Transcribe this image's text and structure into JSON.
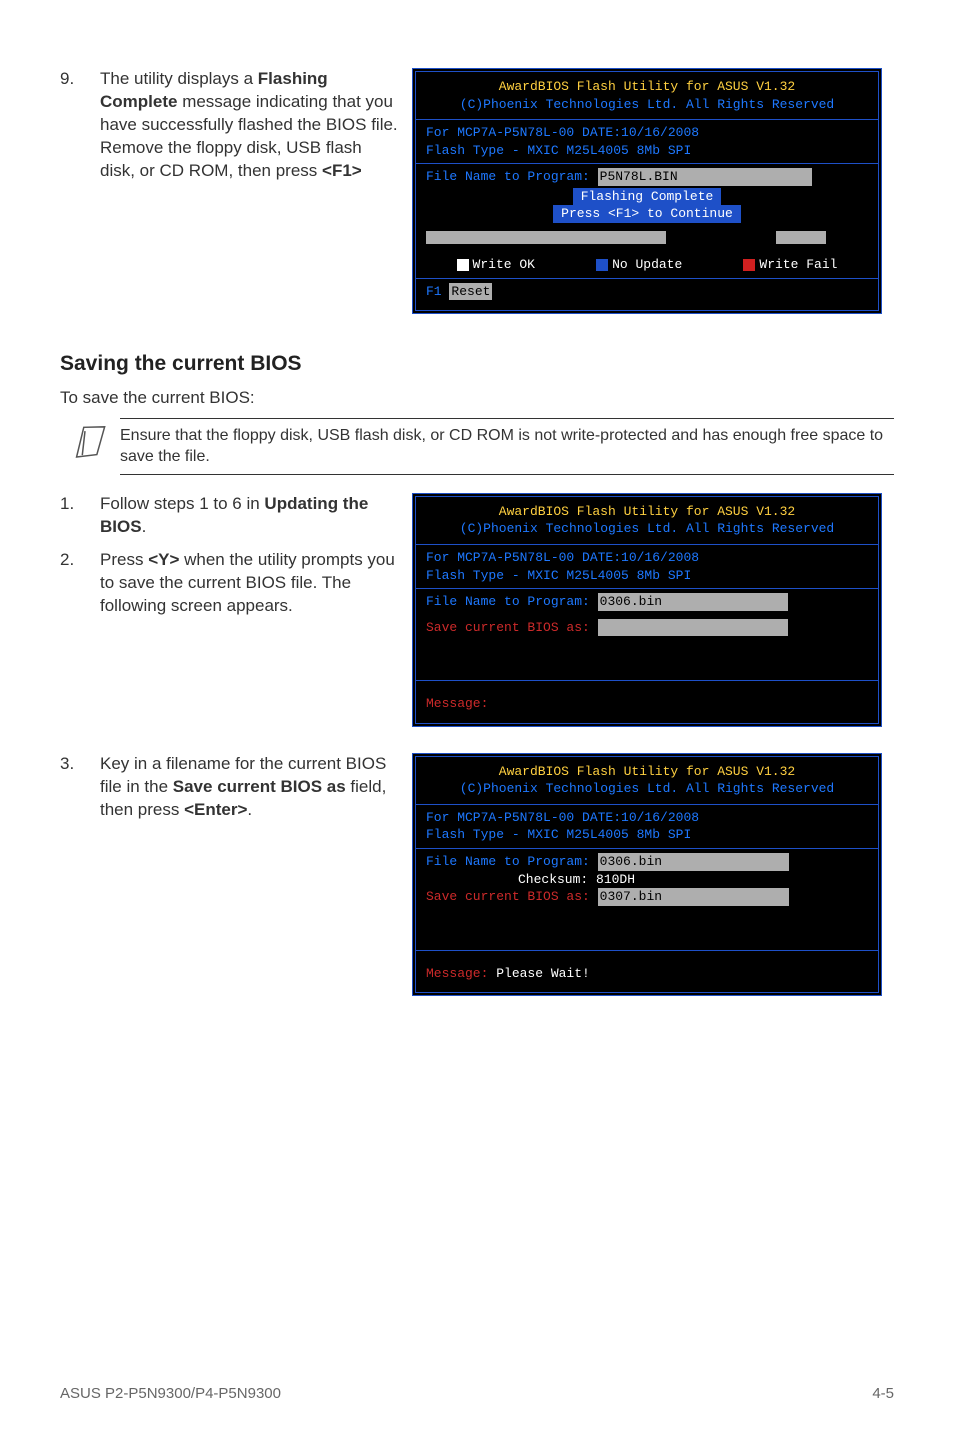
{
  "step9": {
    "num": "9.",
    "text_pre": "The utility displays a ",
    "text_bold": "Flashing Complete",
    "text_post": " message indicating that you have successfully flashed the BIOS file. Remove the floppy disk, USB flash disk, or CD ROM, then press ",
    "text_key": "<F1>"
  },
  "bios1": {
    "title": "AwardBIOS Flash Utility for ASUS V1.32",
    "sub": "(C)Phoenix Technologies Ltd. All Rights Reserved",
    "for": "For MCP7A-P5N78L-00    DATE:10/16/2008",
    "flash": "Flash Type - MXIC M25L4005 8Mb SPI",
    "file_label": "File Name to Program: ",
    "file_val": "P5N78L.BIN",
    "popup1": "Flashing Complete",
    "popup2": "Press <F1> to Continue",
    "legend1": "Write OK",
    "legend2": "No Update",
    "legend3": "Write Fail",
    "f1": "F1",
    "reset": "Reset"
  },
  "section": {
    "heading": "Saving the current BIOS",
    "intro": "To save the current BIOS:",
    "note": "Ensure that the floppy disk, USB flash disk, or CD ROM is not write-protected and has enough free space to save the file."
  },
  "step1": {
    "num": "1.",
    "text_pre": "Follow steps 1 to 6 in ",
    "text_bold": "Updating the BIOS",
    "text_post": "."
  },
  "step2": {
    "num": "2.",
    "text_pre": "Press ",
    "text_key": "<Y>",
    "text_post": " when the utility prompts you to save the current BIOS file. The following screen appears."
  },
  "bios2": {
    "file_label": "File Name to Program: ",
    "file_val": "0306.bin",
    "save_label": "Save current BIOS as: ",
    "msg": " Message:"
  },
  "step3": {
    "num": "3.",
    "text_pre": "Key in a filename for the current BIOS file in the ",
    "text_bold": "Save current BIOS as",
    "text_mid": " field, then press ",
    "text_key": "<Enter>",
    "text_post": "."
  },
  "bios3": {
    "file_label": "File Name to Program: ",
    "file_val": "0306.bin",
    "chk_label": "Checksum: ",
    "chk_val": "810DH",
    "save_label": "Save current BIOS as: ",
    "save_val": "0307.bin",
    "msg_label": " Message: ",
    "msg_val": "Please Wait!"
  },
  "footer": {
    "left": "ASUS P2-P5N9300/P4-P5N9300",
    "right": "4-5"
  }
}
